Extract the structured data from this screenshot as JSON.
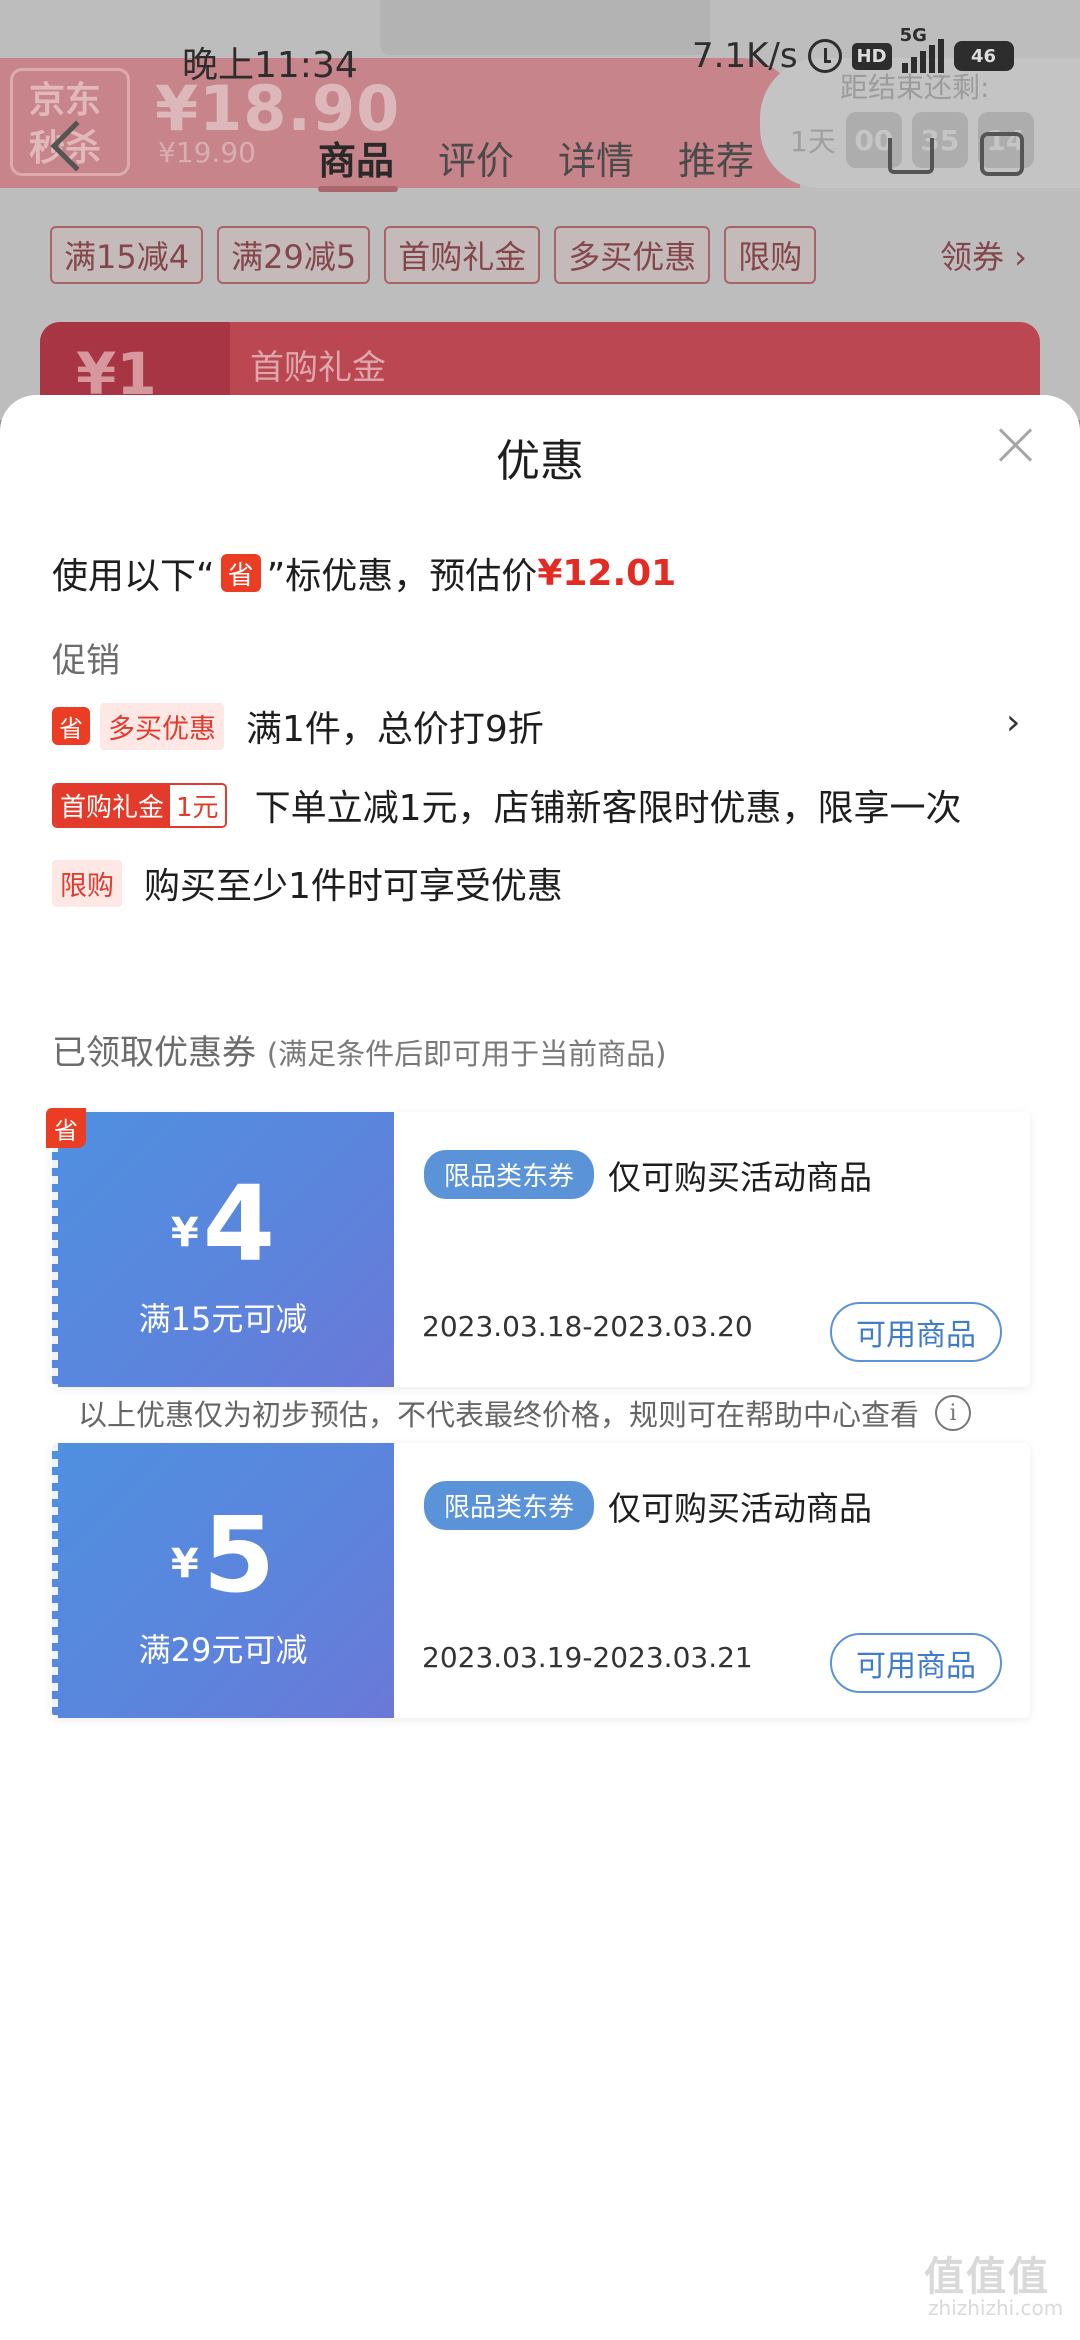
{
  "status_bar": {
    "time": "晚上11:34",
    "net_speed": "7.1K/s",
    "hd": "HD",
    "network": "5G",
    "battery": "46"
  },
  "background_page": {
    "seckill_logo": "京东秒杀",
    "price_main": "¥18.90",
    "price_old": "¥19.90",
    "countdown_label": "距结束还剩:",
    "countdown_day": "1天",
    "countdown": [
      "00",
      "35",
      "14"
    ],
    "tabs": [
      "商品",
      "评价",
      "详情",
      "推荐"
    ],
    "promo_tags": [
      "满15减4",
      "满29减5",
      "首购礼金",
      "多买优惠",
      "限购"
    ],
    "coupon_link": "领券 ›",
    "gift_amount": "¥1",
    "gift_label": "首购礼金"
  },
  "sheet": {
    "title": "优惠",
    "summary_prefix": "使用以下“",
    "summary_badge": "省",
    "summary_suffix": "”标优惠，预估价",
    "summary_price": "¥12.01",
    "promotions_label": "促销",
    "promotions": [
      {
        "badge": "省",
        "tag": "多买优惠",
        "text": "满1件，总价打9折"
      },
      {
        "tag_a": "首购礼金",
        "tag_b": "1元",
        "text": "下单立减1元，店铺新客限时优惠，限享一次"
      },
      {
        "tag": "限购",
        "text": "购买至少1件时可享受优惠"
      }
    ],
    "coupons_label": "已领取优惠券",
    "coupons_sub": "(满足条件后即可用于当前商品)",
    "coupons": [
      {
        "currency": "¥",
        "amount": "4",
        "condition": "满15元可减",
        "badge": "省",
        "type": "限品类东券",
        "desc": "仅可购买活动商品",
        "dates": "2023.03.18-2023.03.20",
        "button": "可用商品"
      },
      {
        "currency": "¥",
        "amount": "5",
        "condition": "满29元可减",
        "type": "限品类东券",
        "desc": "仅可购买活动商品",
        "dates": "2023.03.19-2023.03.21",
        "button": "可用商品"
      }
    ],
    "disclaimer": "以上优惠仅为初步预估，不代表最终价格，规则可在帮助中心查看"
  },
  "watermark": {
    "text": "值值值",
    "sub": "zhizhizhi.com"
  }
}
